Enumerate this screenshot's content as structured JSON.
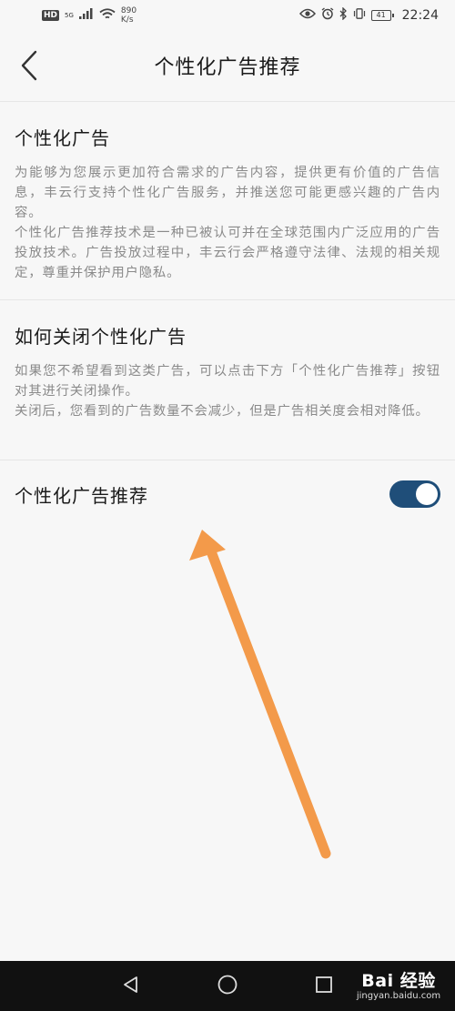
{
  "status_bar": {
    "hd": "HD",
    "network": "5G",
    "speed_value": "890",
    "speed_unit": "K/s",
    "battery": "41",
    "time": "22:24"
  },
  "nav": {
    "title": "个性化广告推荐"
  },
  "sections": [
    {
      "title": "个性化广告",
      "body": "为能够为您展示更加符合需求的广告内容，提供更有价值的广告信息，丰云行支持个性化广告服务，并推送您可能更感兴趣的广告内容。\n个性化广告推荐技术是一种已被认可并在全球范围内广泛应用的广告投放技术。广告投放过程中，丰云行会严格遵守法律、法规的相关规定，尊重并保护用户隐私。"
    },
    {
      "title": "如何关闭个性化广告",
      "body": "如果您不希望看到这类广告，可以点击下方「个性化广告推荐」按钮对其进行关闭操作。\n关闭后，您看到的广告数量不会减少，但是广告相关度会相对降低。"
    }
  ],
  "toggle": {
    "label": "个性化广告推荐",
    "on": true
  },
  "colors": {
    "toggle_on": "#1f4e79",
    "annotation_arrow": "#f39a4a"
  },
  "watermark": {
    "logo": "Bai 经验",
    "sub": "jingyan.baidu.com"
  }
}
